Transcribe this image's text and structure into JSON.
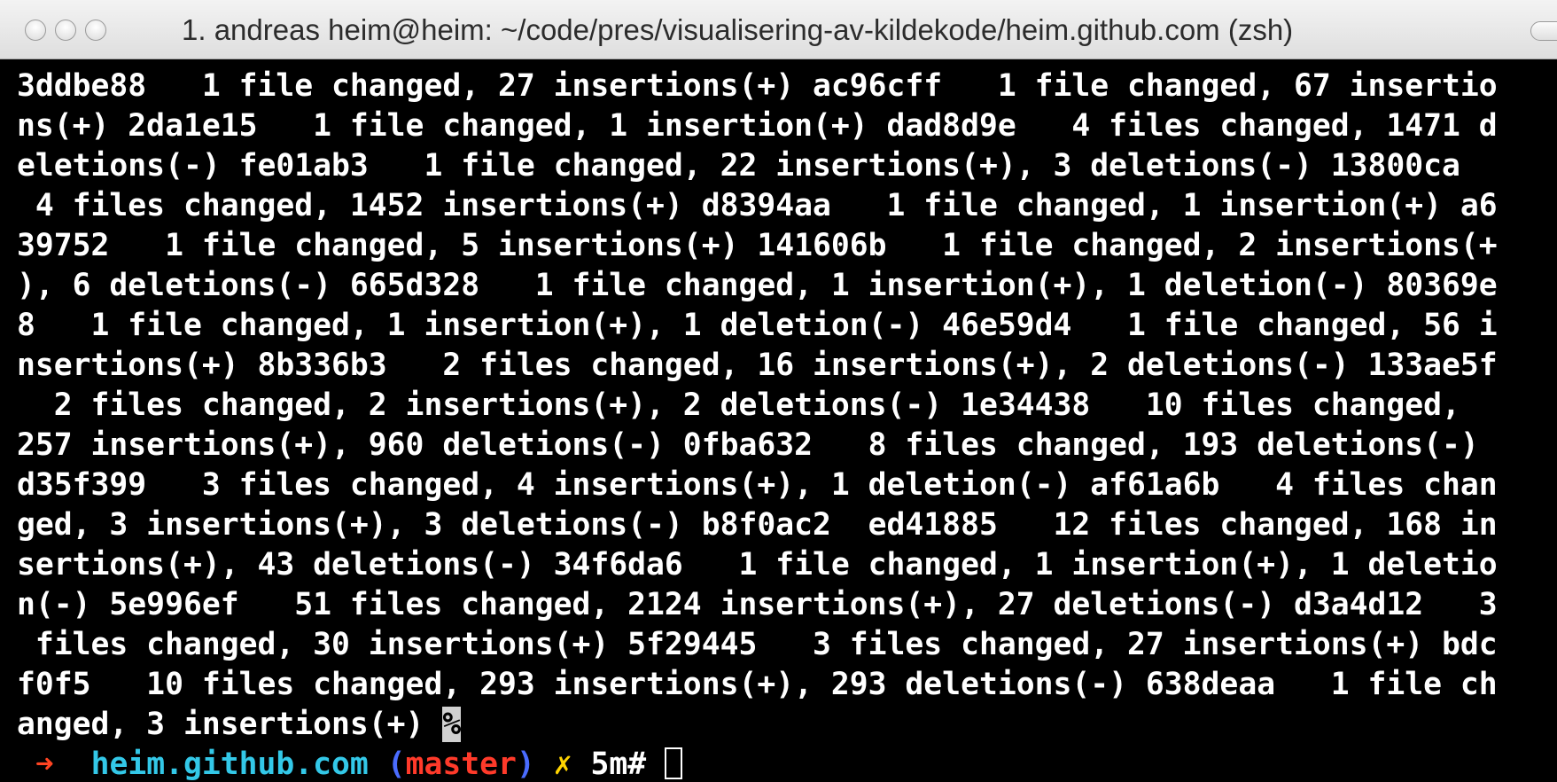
{
  "window": {
    "title": "1. andreas heim@heim: ~/code/pres/visualisering-av-kildekode/heim.github.com (zsh)"
  },
  "terminal": {
    "lines": [
      "3ddbe88   1 file changed, 27 insertions(+) ac96cff   1 file changed, 67 insertio",
      "ns(+) 2da1e15   1 file changed, 1 insertion(+) dad8d9e   4 files changed, 1471 d",
      "eletions(-) fe01ab3   1 file changed, 22 insertions(+), 3 deletions(-) 13800ca",
      " 4 files changed, 1452 insertions(+) d8394aa   1 file changed, 1 insertion(+) a6",
      "39752   1 file changed, 5 insertions(+) 141606b   1 file changed, 2 insertions(+",
      "), 6 deletions(-) 665d328   1 file changed, 1 insertion(+), 1 deletion(-) 80369e",
      "8   1 file changed, 1 insertion(+), 1 deletion(-) 46e59d4   1 file changed, 56 i",
      "nsertions(+) 8b336b3   2 files changed, 16 insertions(+), 2 deletions(-) 133ae5f",
      "  2 files changed, 2 insertions(+), 2 deletions(-) 1e34438   10 files changed,",
      "257 insertions(+), 960 deletions(-) 0fba632   8 files changed, 193 deletions(-)",
      "d35f399   3 files changed, 4 insertions(+), 1 deletion(-) af61a6b   4 files chan",
      "ged, 3 insertions(+), 3 deletions(-) b8f0ac2  ed41885   12 files changed, 168 in",
      "sertions(+), 43 deletions(-) 34f6da6   1 file changed, 1 insertion(+), 1 deletio",
      "n(-) 5e996ef   51 files changed, 2124 insertions(+), 27 deletions(-) d3a4d12   3",
      " files changed, 30 insertions(+) 5f29445   3 files changed, 27 insertions(+) bdc",
      "f0f5   10 files changed, 293 insertions(+), 293 deletions(-) 638deaa   1 file ch",
      "anged, 3 insertions(+) "
    ],
    "end_marker": "%",
    "prompt": {
      "arrow": "➜",
      "host": "heim.github.com",
      "paren_open": "(",
      "branch": "master",
      "paren_close": ")",
      "dirty": "✗",
      "time": "5m#"
    }
  }
}
